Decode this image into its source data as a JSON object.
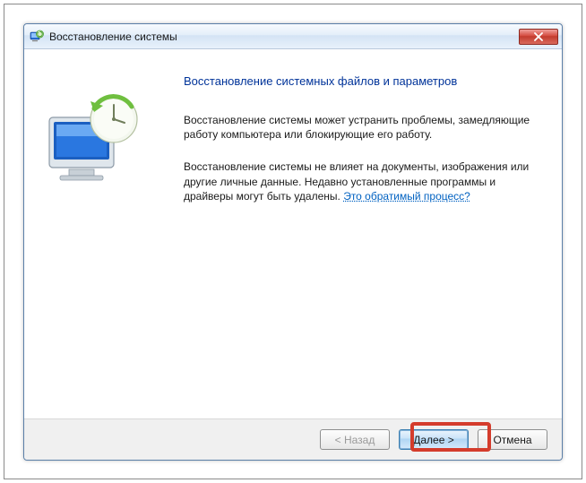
{
  "window": {
    "title": "Восстановление системы"
  },
  "content": {
    "heading": "Восстановление системных файлов и параметров",
    "para1": "Восстановление системы может устранить проблемы, замедляющие работу компьютера или блокирующие его работу.",
    "para2_prefix": "Восстановление системы не влияет на документы, изображения или другие личные данные. Недавно установленные программы и драйверы могут быть удалены. ",
    "link_text": "Это обратимый процесс?"
  },
  "footer": {
    "back_label": "< Назад",
    "next_label": "Далее >",
    "cancel_label": "Отмена"
  }
}
